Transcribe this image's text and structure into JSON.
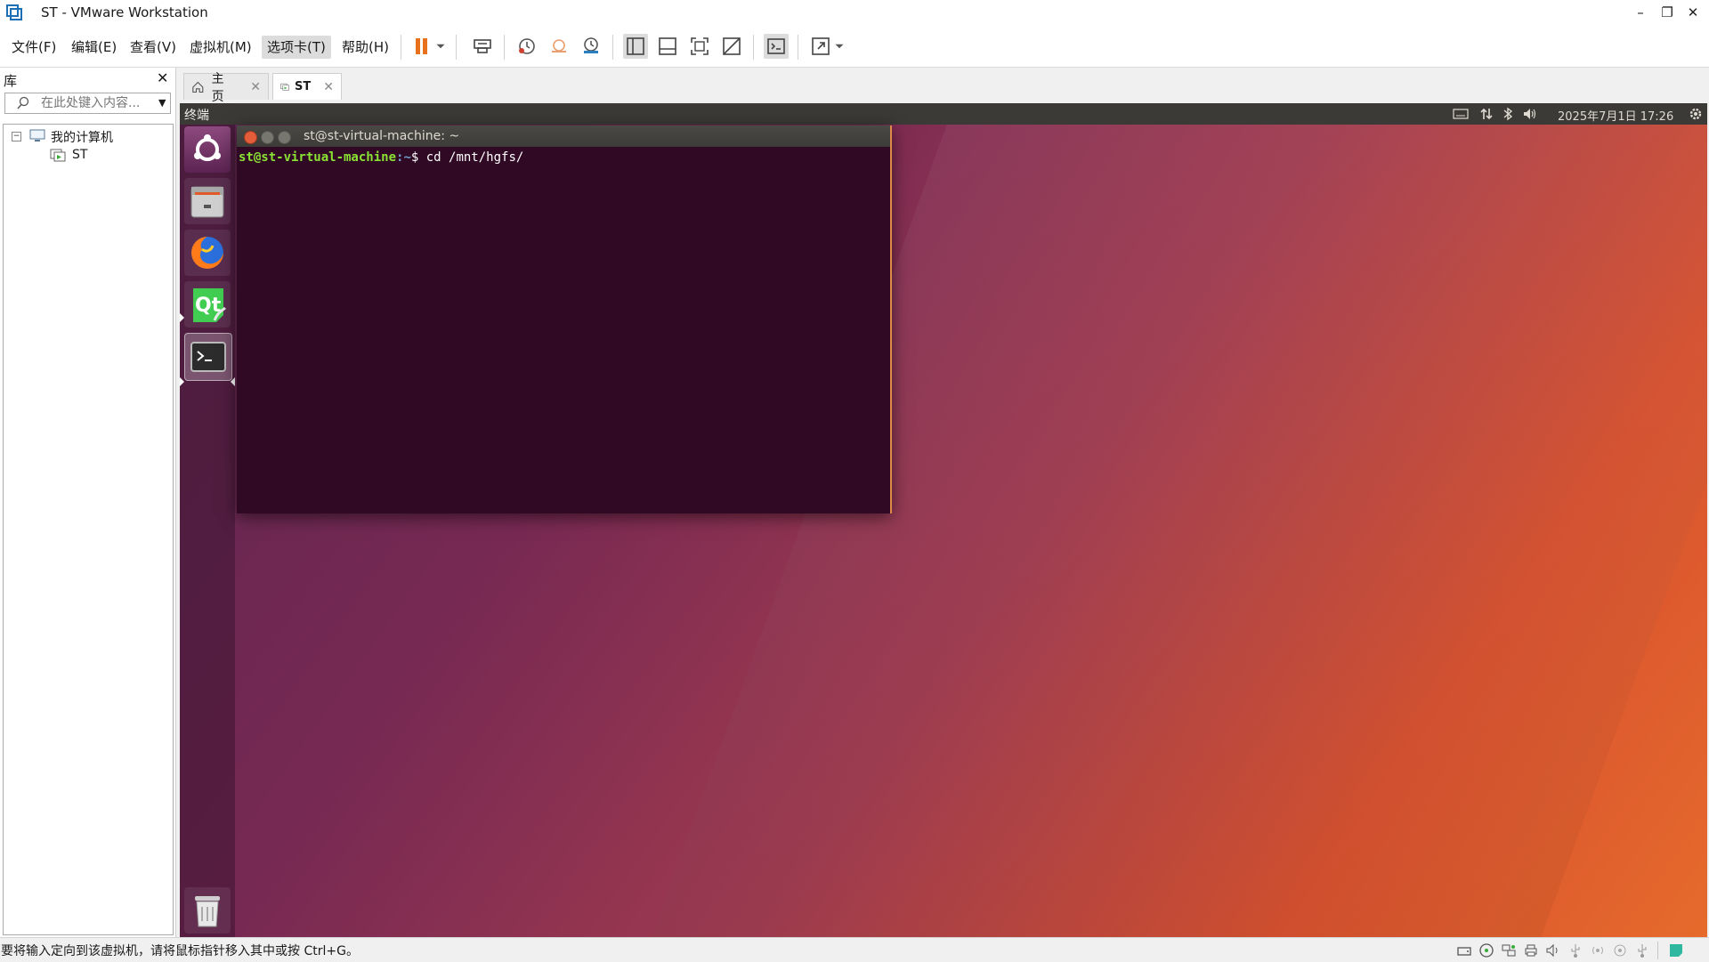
{
  "window": {
    "title": "ST - VMware Workstation",
    "minimize": "–",
    "restore": "❐",
    "close": "✕"
  },
  "menu": {
    "items": [
      {
        "label": "文件(F)",
        "name": "menu-file"
      },
      {
        "label": "编辑(E)",
        "name": "menu-edit"
      },
      {
        "label": "查看(V)",
        "name": "menu-view"
      },
      {
        "label": "虚拟机(M)",
        "name": "menu-vm"
      },
      {
        "label": "选项卡(T)",
        "name": "menu-tabs"
      },
      {
        "label": "帮助(H)",
        "name": "menu-help"
      }
    ]
  },
  "toolbar": {
    "icons": [
      "pause-icon",
      "send-ctrl-alt-del-icon",
      "snapshot-icon",
      "revert-snapshot-icon",
      "snapshot-manager-icon",
      "show-library-icon",
      "thumbnail-bar-icon",
      "full-screen-icon",
      "unity-icon",
      "console-icon",
      "stretch-icon"
    ]
  },
  "library": {
    "title": "库",
    "close": "✕",
    "search_placeholder": "在此处键入内容...",
    "tree": {
      "root": "我的计算机",
      "children": [
        "ST"
      ]
    }
  },
  "tabs": [
    {
      "label": "主页",
      "active": false
    },
    {
      "label": "ST",
      "active": true
    }
  ],
  "guest": {
    "topbar_title": "终端",
    "clock": "2025年7月1日 17:26",
    "terminal": {
      "title": "st@st-virtual-machine: ~",
      "prompt_user": "st@st-virtual-machine",
      "prompt_path": ":~",
      "prompt_symbol": "$ ",
      "command": "cd /mnt/hgfs/"
    }
  },
  "status": {
    "text": "要将输入定向到该虚拟机，请将鼠标指针移入其中或按 Ctrl+G。"
  },
  "colors": {
    "terminal_bg": "#300a24",
    "accent_orange": "#e95420",
    "pause_orange": "#e8711c"
  }
}
